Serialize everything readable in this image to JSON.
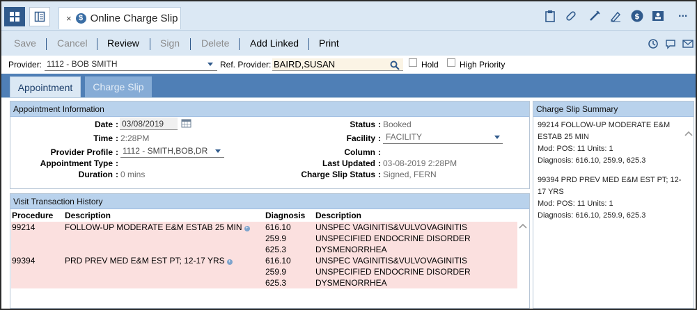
{
  "window": {
    "tab_title": "Online Charge Slip",
    "tab_close": "×",
    "more_label": "..."
  },
  "toolbar": {
    "save": "Save",
    "cancel": "Cancel",
    "review": "Review",
    "sign": "Sign",
    "delete": "Delete",
    "add_linked": "Add Linked",
    "print": "Print"
  },
  "provider_row": {
    "provider_label": "Provider:",
    "provider_value": "1112 - BOB SMITH",
    "ref_provider_label": "Ref. Provider:",
    "ref_provider_value": "BAIRD,SUSAN",
    "hold_label": "Hold",
    "high_priority_label": "High Priority"
  },
  "tabs": {
    "appointment": "Appointment",
    "charge_slip": "Charge Slip"
  },
  "appointment_info": {
    "header": "Appointment Information",
    "date_label": "Date",
    "date_value": "03/08/2019",
    "time_label": "Time",
    "time_value": "2:28PM",
    "provider_profile_label": "Provider Profile",
    "provider_profile_value": "1112 - SMITH,BOB,DR",
    "appointment_type_label": "Appointment Type",
    "duration_label": "Duration",
    "duration_value": "0 mins",
    "status_label": "Status",
    "status_value": "Booked",
    "facility_label": "Facility",
    "facility_value": "FACILITY",
    "column_label": "Column",
    "last_updated_label": "Last Updated",
    "last_updated_value": "03-08-2019 2:28PM",
    "charge_slip_status_label": "Charge Slip Status",
    "charge_slip_status_value": "Signed, FERN"
  },
  "visit_history": {
    "header": "Visit Transaction History",
    "columns": [
      "Procedure",
      "Description",
      "Diagnosis",
      "Description"
    ],
    "rows": [
      {
        "procedure": "99214",
        "description": "FOLLOW-UP MODERATE E&M ESTAB 25 MIN",
        "diagnosis": "616.10",
        "diag_description": "UNSPEC VAGINITIS&VULVOVAGINITIS"
      },
      {
        "procedure": "",
        "description": "",
        "diagnosis": "259.9",
        "diag_description": "UNSPECIFIED ENDOCRINE DISORDER"
      },
      {
        "procedure": "",
        "description": "",
        "diagnosis": "625.3",
        "diag_description": "DYSMENORRHEA"
      },
      {
        "procedure": "99394",
        "description": "PRD PREV MED E&M EST PT; 12-17 YRS",
        "diagnosis": "616.10",
        "diag_description": "UNSPEC VAGINITIS&VULVOVAGINITIS"
      },
      {
        "procedure": "",
        "description": "",
        "diagnosis": "259.9",
        "diag_description": "UNSPECIFIED ENDOCRINE DISORDER"
      },
      {
        "procedure": "",
        "description": "",
        "diagnosis": "625.3",
        "diag_description": "DYSMENORRHEA"
      }
    ]
  },
  "summary": {
    "header": "Charge Slip Summary",
    "items": [
      {
        "title": "99214 FOLLOW-UP MODERATE E&M ESTAB 25 MIN",
        "mod": "Mod: POS: 11 Units: 1",
        "diagnosis": "Diagnosis: 616.10, 259.9, 625.3"
      },
      {
        "title": "99394 PRD PREV MED E&M EST PT; 12-17 YRS",
        "mod": "Mod: POS: 11 Units: 1",
        "diagnosis": "Diagnosis: 616.10, 259.9, 625.3"
      }
    ]
  },
  "colors": {
    "accent": "#305a8c",
    "tab_bar": "#4f7fb6",
    "panel_header": "#b9d2ec",
    "row_highlight": "#fbe0df"
  }
}
